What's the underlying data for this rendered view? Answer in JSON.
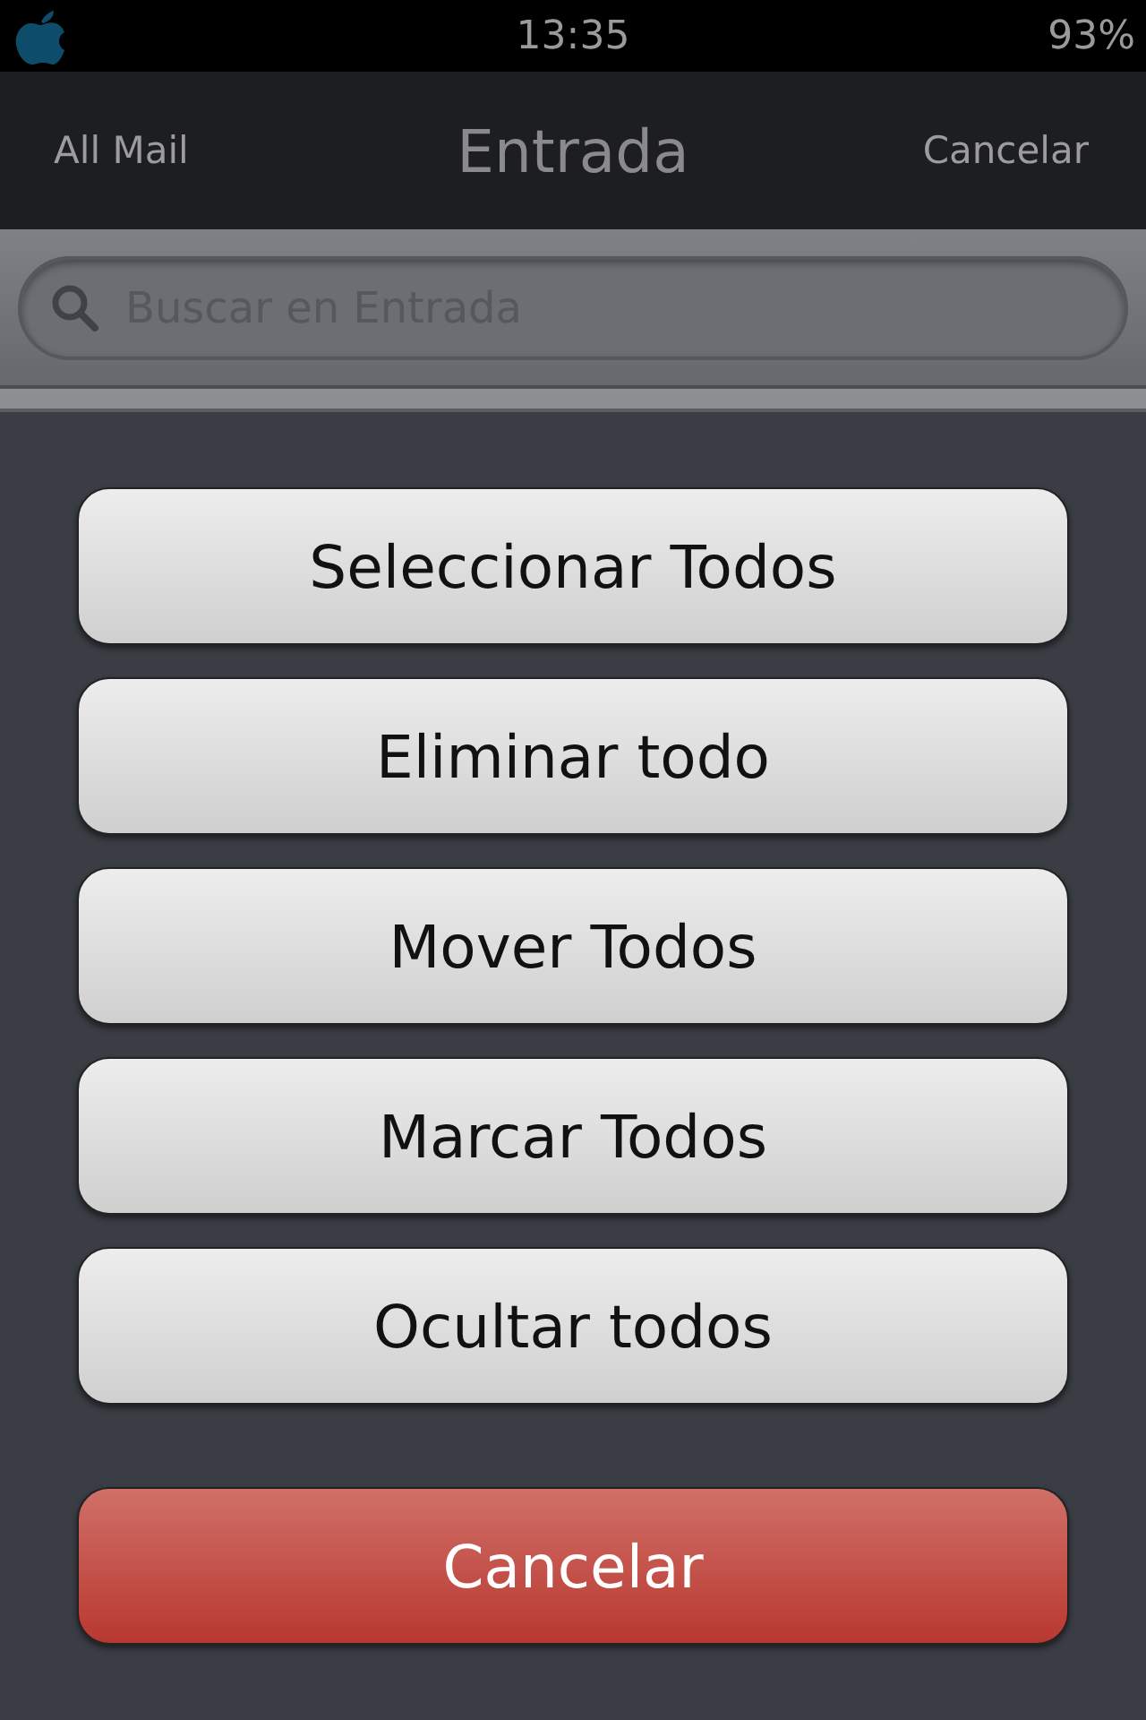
{
  "status_bar": {
    "time": "13:35",
    "battery": "93%"
  },
  "nav_bar": {
    "left": "All Mail",
    "title": "Entrada",
    "right": "Cancelar"
  },
  "search": {
    "placeholder": "Buscar en Entrada"
  },
  "action_sheet": {
    "buttons": [
      {
        "label": "Seleccionar Todos",
        "kind": "default"
      },
      {
        "label": "Eliminar todo",
        "kind": "default"
      },
      {
        "label": "Mover Todos",
        "kind": "default"
      },
      {
        "label": "Marcar Todos",
        "kind": "default"
      },
      {
        "label": "Ocultar todos",
        "kind": "default"
      },
      {
        "label": "Cancelar",
        "kind": "cancel"
      }
    ]
  }
}
